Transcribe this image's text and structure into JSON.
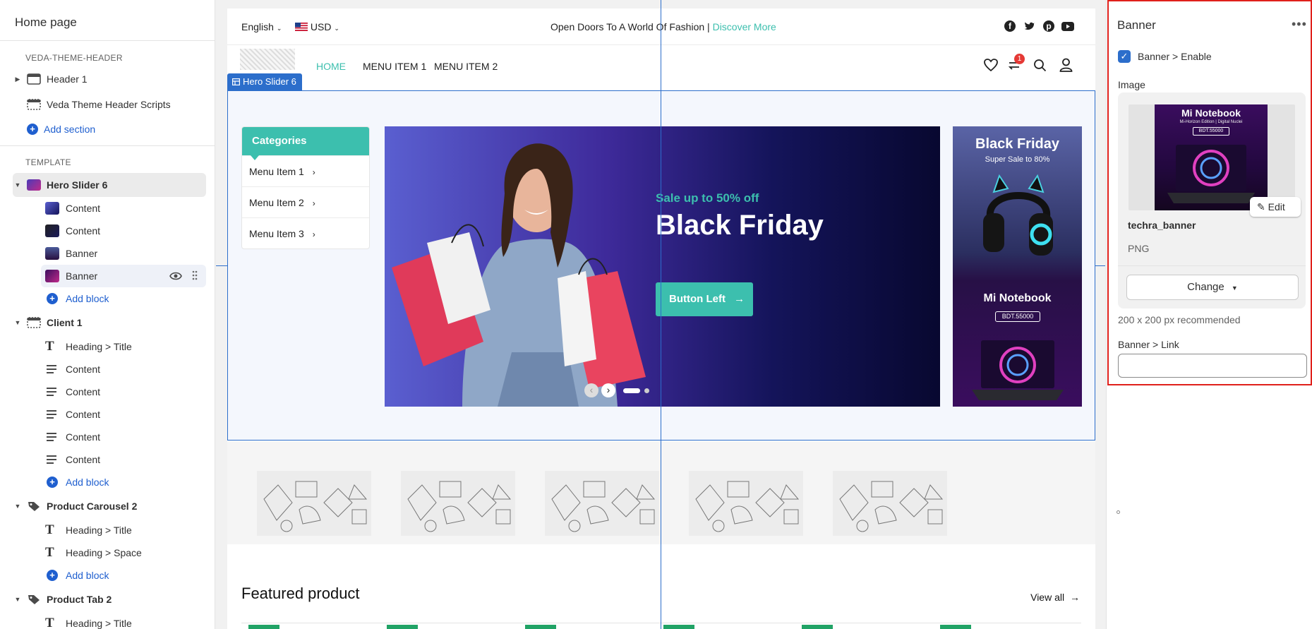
{
  "sidebar": {
    "title": "Home page",
    "header_group": "VEDA-THEME-HEADER",
    "header_items": [
      "Header 1",
      "Veda Theme Header Scripts"
    ],
    "add_section": "Add section",
    "template_group": "TEMPLATE",
    "hero": {
      "label": "Hero Slider 6",
      "blocks": [
        "Content",
        "Content",
        "Banner",
        "Banner"
      ],
      "add_block": "Add block"
    },
    "client": {
      "label": "Client 1",
      "blocks": [
        "Heading > Title",
        "Content",
        "Content",
        "Content",
        "Content",
        "Content"
      ],
      "add_block": "Add block"
    },
    "carousel": {
      "label": "Product Carousel 2",
      "blocks": [
        "Heading > Title",
        "Heading > Space"
      ],
      "add_block": "Add block"
    },
    "tab": {
      "label": "Product Tab 2",
      "blocks": [
        "Heading > Title"
      ]
    }
  },
  "preview": {
    "topbar": {
      "language": "English",
      "currency": "USD",
      "announcement": "Open Doors To A World Of Fashion |",
      "announcement_link": "Discover More"
    },
    "nav": {
      "items": [
        "HOME",
        "MENU ITEM 1",
        "MENU ITEM 2"
      ],
      "cart_count": "1"
    },
    "hero_tag": "Hero Slider 6",
    "categories": {
      "heading": "Categories",
      "items": [
        "Menu Item 1",
        "Menu Item 2",
        "Menu Item 3"
      ]
    },
    "slide": {
      "subtitle": "Sale up to 50% off",
      "title": "Black Friday",
      "button": "Button Left"
    },
    "side_banner": {
      "top_title": "Black Friday",
      "top_subtitle": "Super Sale to 80%",
      "bottom_title": "Mi Notebook",
      "bottom_price": "BDT.55000"
    },
    "featured": {
      "title": "Featured product",
      "view_all": "View all"
    }
  },
  "panel": {
    "title": "Banner",
    "enable_label": "Banner > Enable",
    "enable_checked": true,
    "image_label": "Image",
    "thumb_title": "Mi Notebook",
    "thumb_sub": "Mi-Horizon Edition | Digital Nuclei",
    "thumb_price": "BDT.55000",
    "edit": "Edit",
    "file_name": "techra_banner",
    "file_type": "PNG",
    "change": "Change",
    "hint": "200 x 200 px recommended",
    "link_label": "Banner > Link",
    "link_value": ""
  },
  "colors": {
    "accent_teal": "#3cbfae",
    "selection_blue": "#2c6ecb",
    "panel_outline": "#e0201b",
    "link_blue": "#1f5fcf"
  }
}
